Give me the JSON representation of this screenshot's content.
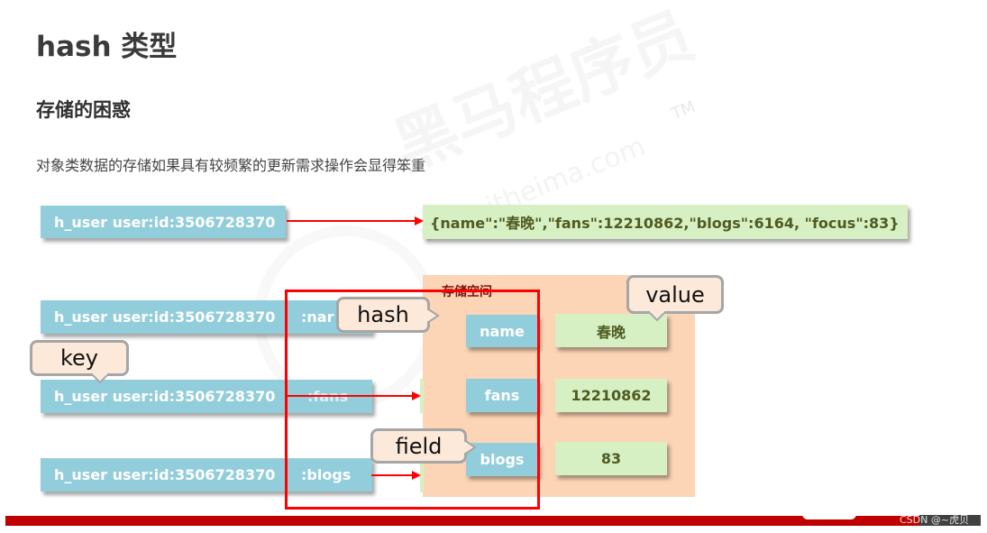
{
  "header": {
    "title": "hash 类型",
    "subtitle": "存储的困惑",
    "description": "对象类数据的存储如果具有较频繁的更新需求操作会显得笨重"
  },
  "watermark": {
    "brand": "黑马程序员",
    "trademark": "TM",
    "url": "www.itheima.com"
  },
  "string_example": {
    "key": "h_user user:id:3506728370",
    "value": "{name\":\"春晚\",\"fans\":12210862,\"blogs\":6164, \"focus\":83}"
  },
  "split_keys": [
    {
      "key": "h_user user:id:3506728370",
      "suffix": ":nar"
    },
    {
      "key": "h_user user:id:3506728370",
      "suffix": ":fans"
    },
    {
      "key": "h_user user:id:3506728370",
      "suffix": ":blogs"
    }
  ],
  "storage": {
    "label": "存储空间",
    "rows": [
      {
        "field": "name",
        "value": "春晚"
      },
      {
        "field": "fans",
        "value": "12210862"
      },
      {
        "field": "blogs",
        "value": "83"
      }
    ]
  },
  "callouts": {
    "hash": "hash",
    "key": "key",
    "field": "field",
    "value": "value"
  },
  "footer": {
    "credit": "CSDN @~虎贝"
  },
  "colors": {
    "key_box": "#92cddc",
    "value_box": "#d7f0c3",
    "storage_bg": "#fbd5b5",
    "highlight_red": "#ff0000",
    "bottom_bar": "#c00000",
    "callout_bg": "#fde9d9"
  }
}
